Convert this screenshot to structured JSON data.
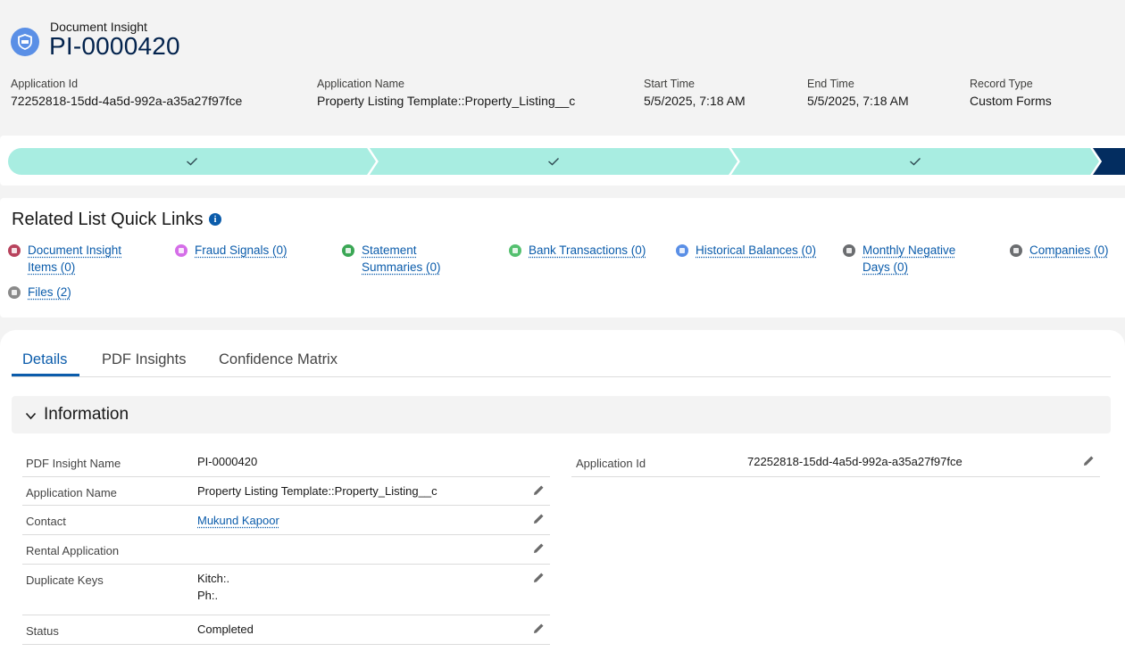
{
  "header": {
    "icon": "document-insight-shield-icon",
    "object_label": "Document Insight",
    "record_title": "PI-0000420",
    "fields": [
      {
        "label": "Application Id",
        "value": "72252818-15dd-4a5d-992a-a35a27f97fce"
      },
      {
        "label": "Application Name",
        "value": "Property Listing Template::Property_Listing__c"
      },
      {
        "label": "Start Time",
        "value": "5/5/2025, 7:18 AM"
      },
      {
        "label": "End Time",
        "value": "5/5/2025, 7:18 AM"
      },
      {
        "label": "Record Type",
        "value": "Custom Forms"
      }
    ]
  },
  "path": {
    "stages": [
      {
        "status": "complete",
        "icon": "check-icon"
      },
      {
        "status": "complete",
        "icon": "check-icon"
      },
      {
        "status": "complete",
        "icon": "check-icon"
      },
      {
        "status": "current"
      }
    ],
    "colors": {
      "complete": "#a8ede1",
      "current": "#032d60"
    }
  },
  "related_links": {
    "title": "Related List Quick Links",
    "info_icon": "info-icon",
    "links": [
      {
        "label": "Document Insight Items (0)",
        "icon": "document-insight-items-icon",
        "color": "#b8435d"
      },
      {
        "label": "Fraud Signals (0)",
        "icon": "fraud-signals-icon",
        "color": "#d56ee8"
      },
      {
        "label": "Statement Summaries (0)",
        "icon": "statement-summaries-icon",
        "color": "#3ba755"
      },
      {
        "label": "Bank Transactions (0)",
        "icon": "bank-transactions-icon",
        "color": "#54c06f"
      },
      {
        "label": "Historical Balances (0)",
        "icon": "historical-balances-icon",
        "color": "#5a8fe6"
      },
      {
        "label": "Monthly Negative Days (0)",
        "icon": "monthly-negative-days-icon",
        "color": "#6b6d70"
      },
      {
        "label": "Companies (0)",
        "icon": "companies-icon",
        "color": "#6b6d70"
      },
      {
        "label": "Files (2)",
        "icon": "files-icon",
        "color": "#8a8a8a"
      }
    ]
  },
  "tabs": [
    {
      "label": "Details",
      "active": true
    },
    {
      "label": "PDF Insights",
      "active": false
    },
    {
      "label": "Confidence Matrix",
      "active": false
    }
  ],
  "section": {
    "title": "Information",
    "left_fields": [
      {
        "label": "PDF Insight Name",
        "value": "PI-0000420",
        "editable": false
      },
      {
        "label": "Application Name",
        "value": "Property Listing Template::Property_Listing__c",
        "editable": true
      },
      {
        "label": "Contact",
        "value": "Mukund Kapoor",
        "editable": true,
        "link": true
      },
      {
        "label": "Rental Application",
        "value": "",
        "editable": true
      },
      {
        "label": "Duplicate Keys",
        "value": "Kitch:.\nPh:.",
        "editable": true
      },
      {
        "label": "Status",
        "value": "Completed",
        "editable": true
      }
    ],
    "right_fields": [
      {
        "label": "Application Id",
        "value": "72252818-15dd-4a5d-992a-a35a27f97fce",
        "editable": true
      }
    ]
  },
  "colors": {
    "brand": "#0b5cab",
    "title_navy": "#03234d",
    "path_complete": "#a8ede1",
    "path_current": "#032d60"
  }
}
